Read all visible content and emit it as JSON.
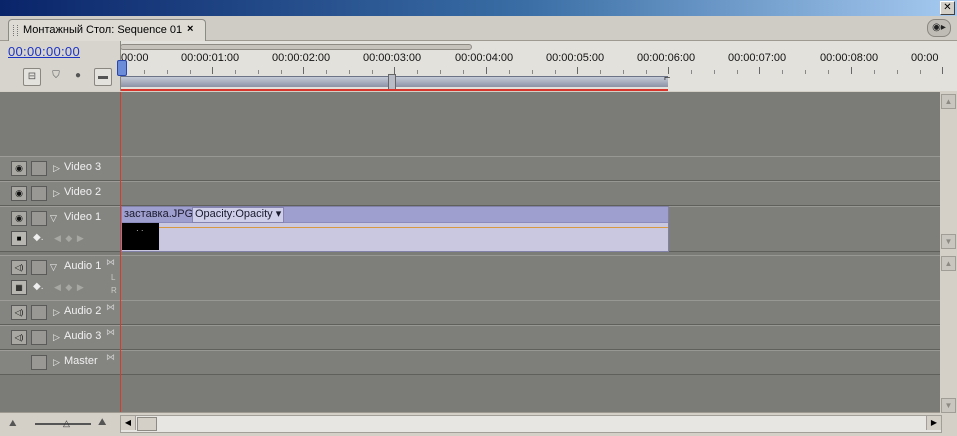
{
  "window": {
    "close_glyph": "✕"
  },
  "tab": {
    "label": "Монтажный Стол: Sequence 01",
    "close": "×"
  },
  "panel_menu": {
    "glyph": "◉▸"
  },
  "timecode": "00:00:00:00",
  "toolbar": {
    "snap_icon": "snap-icon",
    "marker_icon": "marker-icon",
    "keyframe_icon": "keyframe-icon",
    "zoom_icon": "zoom-icon"
  },
  "ruler": {
    "ticks": [
      "00:00",
      "00:00:01:00",
      "00:00:02:00",
      "00:00:03:00",
      "00:00:04:00",
      "00:00:05:00",
      "00:00:06:00",
      "00:00:07:00",
      "00:00:08:00",
      "00:00"
    ]
  },
  "tracks": {
    "video3": {
      "name": "Video 3"
    },
    "video2": {
      "name": "Video 2"
    },
    "video1": {
      "name": "Video 1"
    },
    "audio1": {
      "name": "Audio 1",
      "l": "L",
      "r": "R"
    },
    "audio2": {
      "name": "Audio 2"
    },
    "audio3": {
      "name": "Audio 3"
    },
    "master": {
      "name": "Master"
    }
  },
  "clip": {
    "name": "заставка.JPG",
    "opacity_label": "Opacity:Opacity ▾"
  },
  "glyphs": {
    "eye": "👁",
    "speaker": "◁)",
    "tri_right": "▷",
    "tri_down": "▽",
    "keys": "◀ ◆ ▶",
    "stereo": "⋈",
    "up": "▲",
    "down": "▼",
    "left": "◀",
    "right": "▶"
  },
  "colors": {
    "timecode": "#1d35c5",
    "playhead": "#d43c2c",
    "clip": "#9f9fcf"
  }
}
